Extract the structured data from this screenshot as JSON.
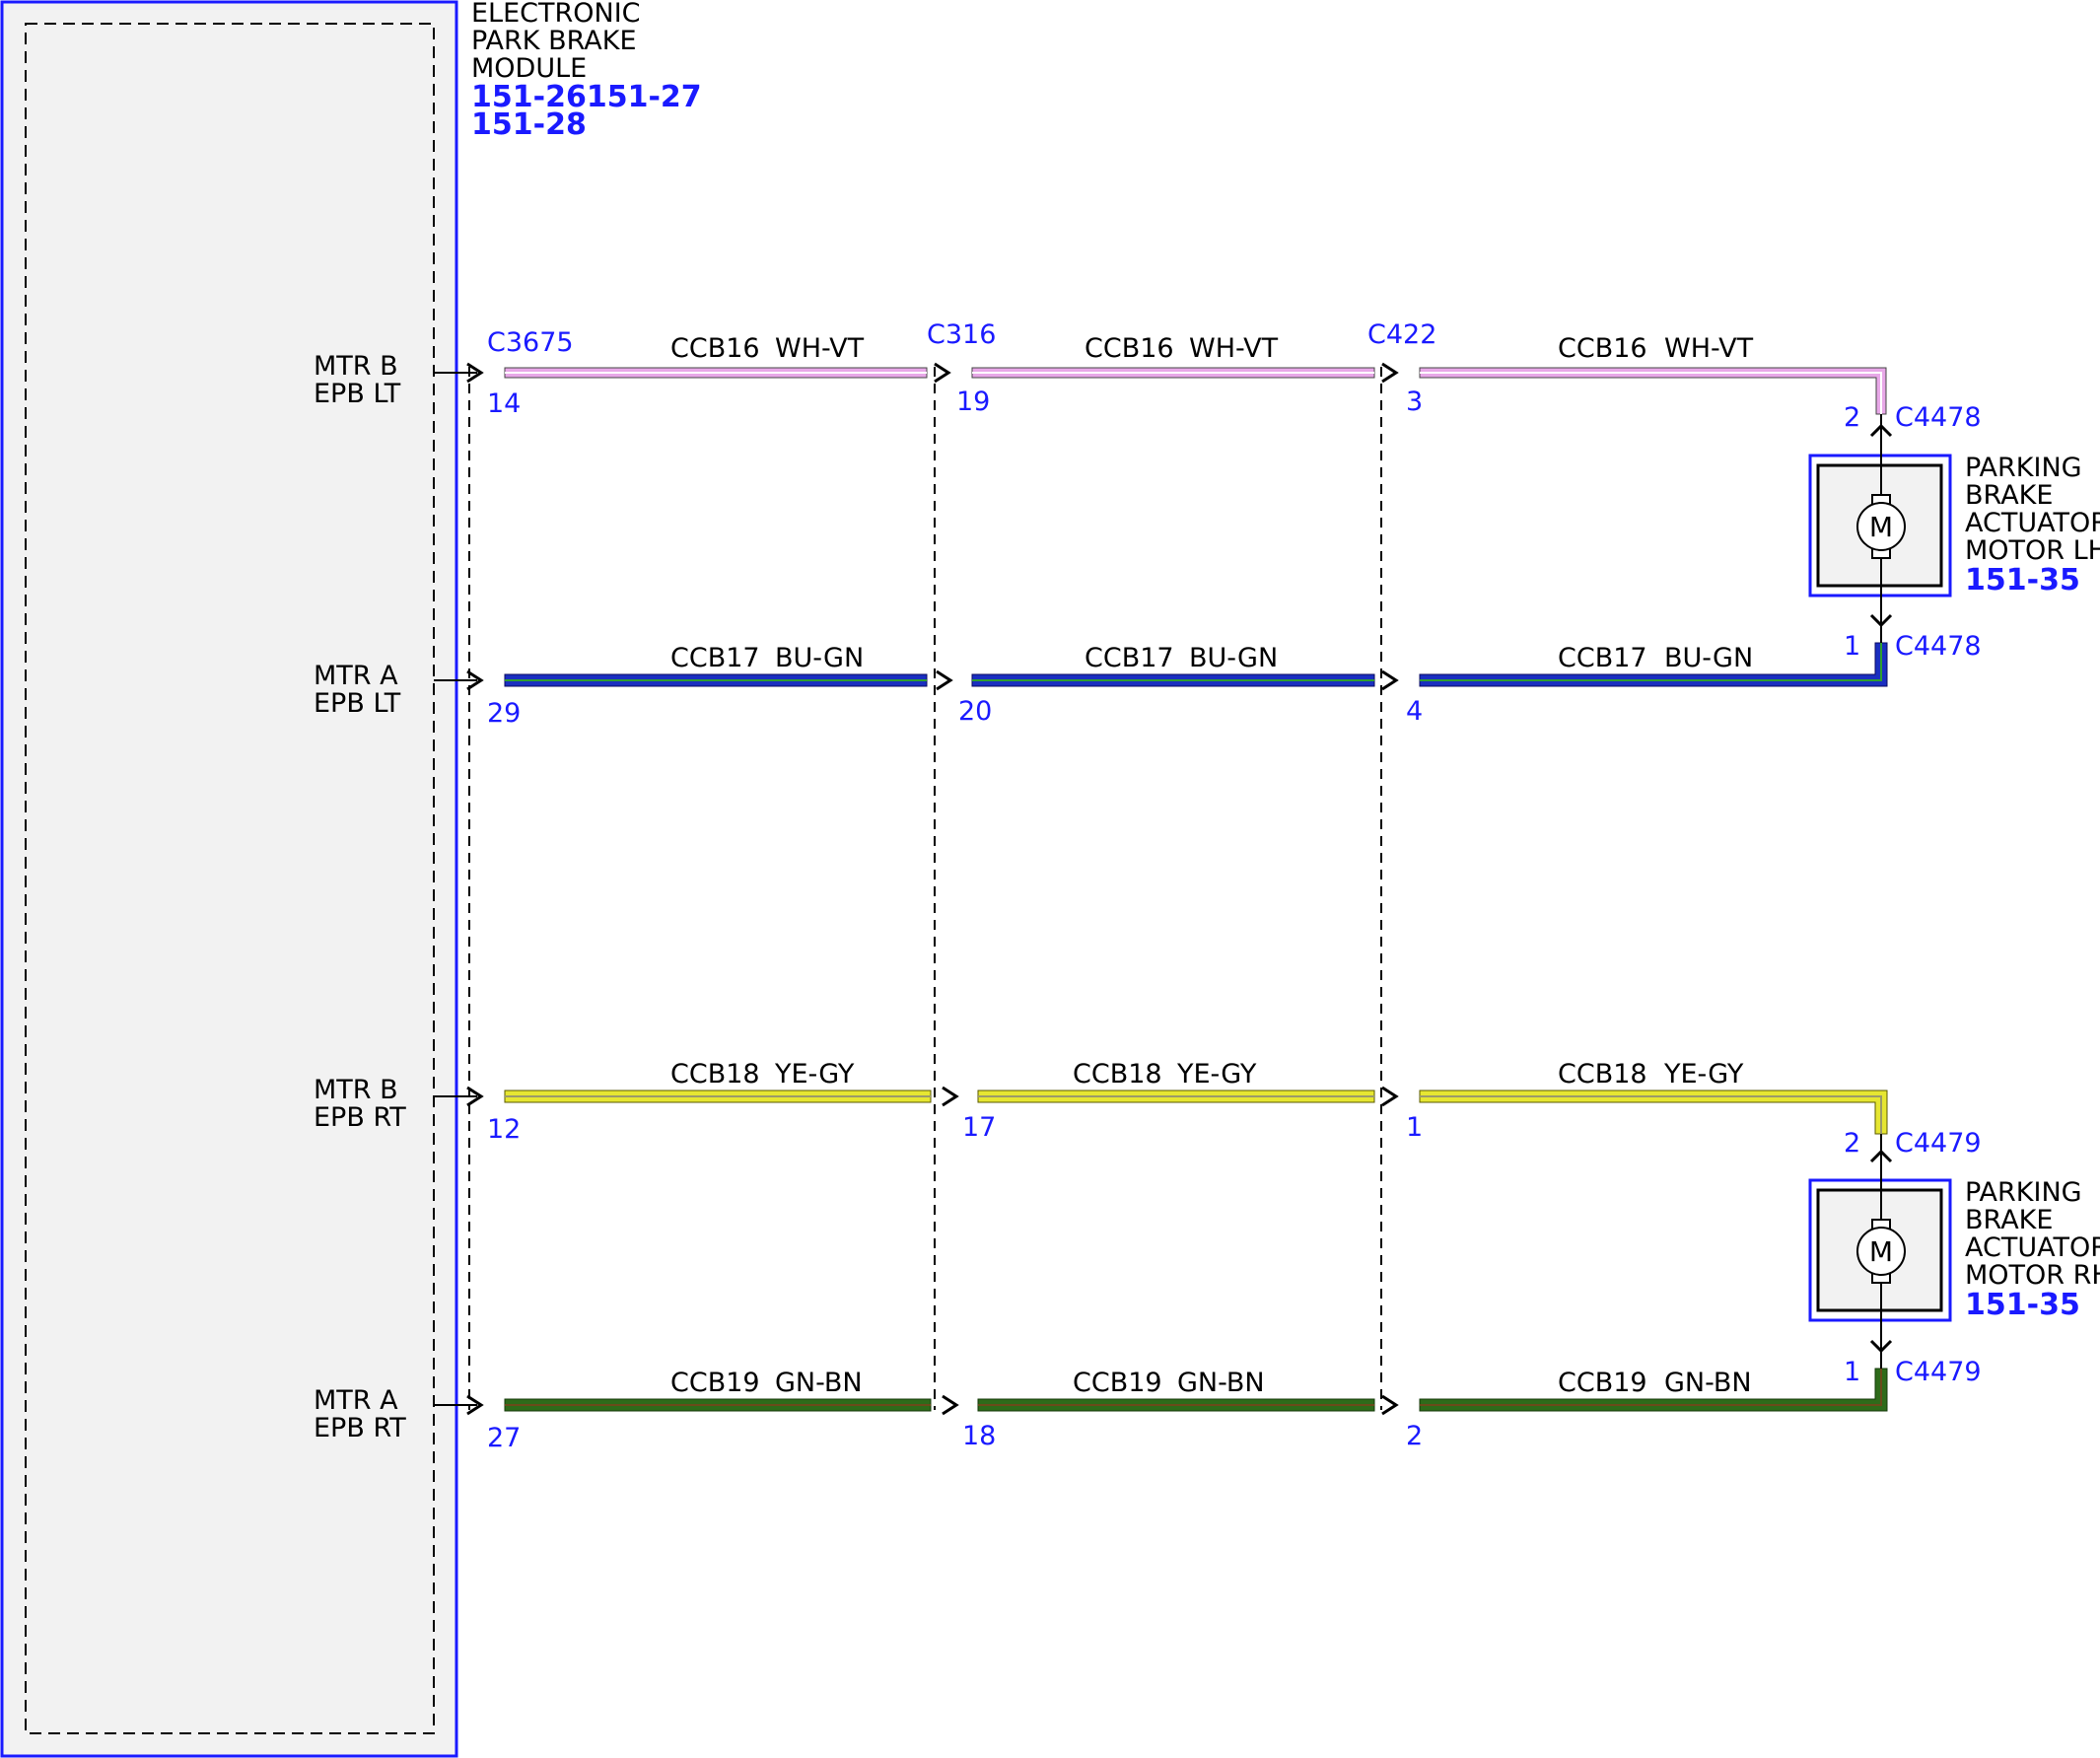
{
  "colors": {
    "border_blue": "#1a1aff",
    "module_fill": "#f2f2f2",
    "wire_wh_vt": "#e8a8e8",
    "wire_bu_gn": "#1a2fc0",
    "wire_ye_gy": "#e6e632",
    "wire_gn_bn": "#2e6b1a"
  },
  "module": {
    "name_lines": [
      "ELECTRONIC",
      "PARK BRAKE",
      "MODULE"
    ],
    "refs": [
      "151-26151-27",
      "151-28"
    ]
  },
  "connectors": {
    "module": "C3675",
    "inline1": "C316",
    "inline2": "C422"
  },
  "circuits": [
    {
      "id": "mtr-b-epb-lt",
      "pin_label": [
        "MTR B",
        "EPB LT"
      ],
      "circuit": "CCB16",
      "color_code": "WH-VT",
      "pins": [
        "14",
        "19",
        "3"
      ],
      "device_pin": "2",
      "device_connector": "C4478"
    },
    {
      "id": "mtr-a-epb-lt",
      "pin_label": [
        "MTR A",
        "EPB LT"
      ],
      "circuit": "CCB17",
      "color_code": "BU-GN",
      "pins": [
        "29",
        "20",
        "4"
      ],
      "device_pin": "1",
      "device_connector": "C4478"
    },
    {
      "id": "mtr-b-epb-rt",
      "pin_label": [
        "MTR B",
        "EPB RT"
      ],
      "circuit": "CCB18",
      "color_code": "YE-GY",
      "pins": [
        "12",
        "17",
        "1"
      ],
      "device_pin": "2",
      "device_connector": "C4479"
    },
    {
      "id": "mtr-a-epb-rt",
      "pin_label": [
        "MTR A",
        "EPB RT"
      ],
      "circuit": "CCB19",
      "color_code": "GN-BN",
      "pins": [
        "27",
        "18",
        "2"
      ],
      "device_pin": "1",
      "device_connector": "C4479"
    }
  ],
  "motors": [
    {
      "id": "lh",
      "name_lines": [
        "PARKING",
        "BRAKE",
        "ACTUATOR",
        "MOTOR LH"
      ],
      "ref": "151-35",
      "symbol": "M"
    },
    {
      "id": "rh",
      "name_lines": [
        "PARKING",
        "BRAKE",
        "ACTUATOR",
        "MOTOR RH"
      ],
      "ref": "151-35",
      "symbol": "M"
    }
  ]
}
